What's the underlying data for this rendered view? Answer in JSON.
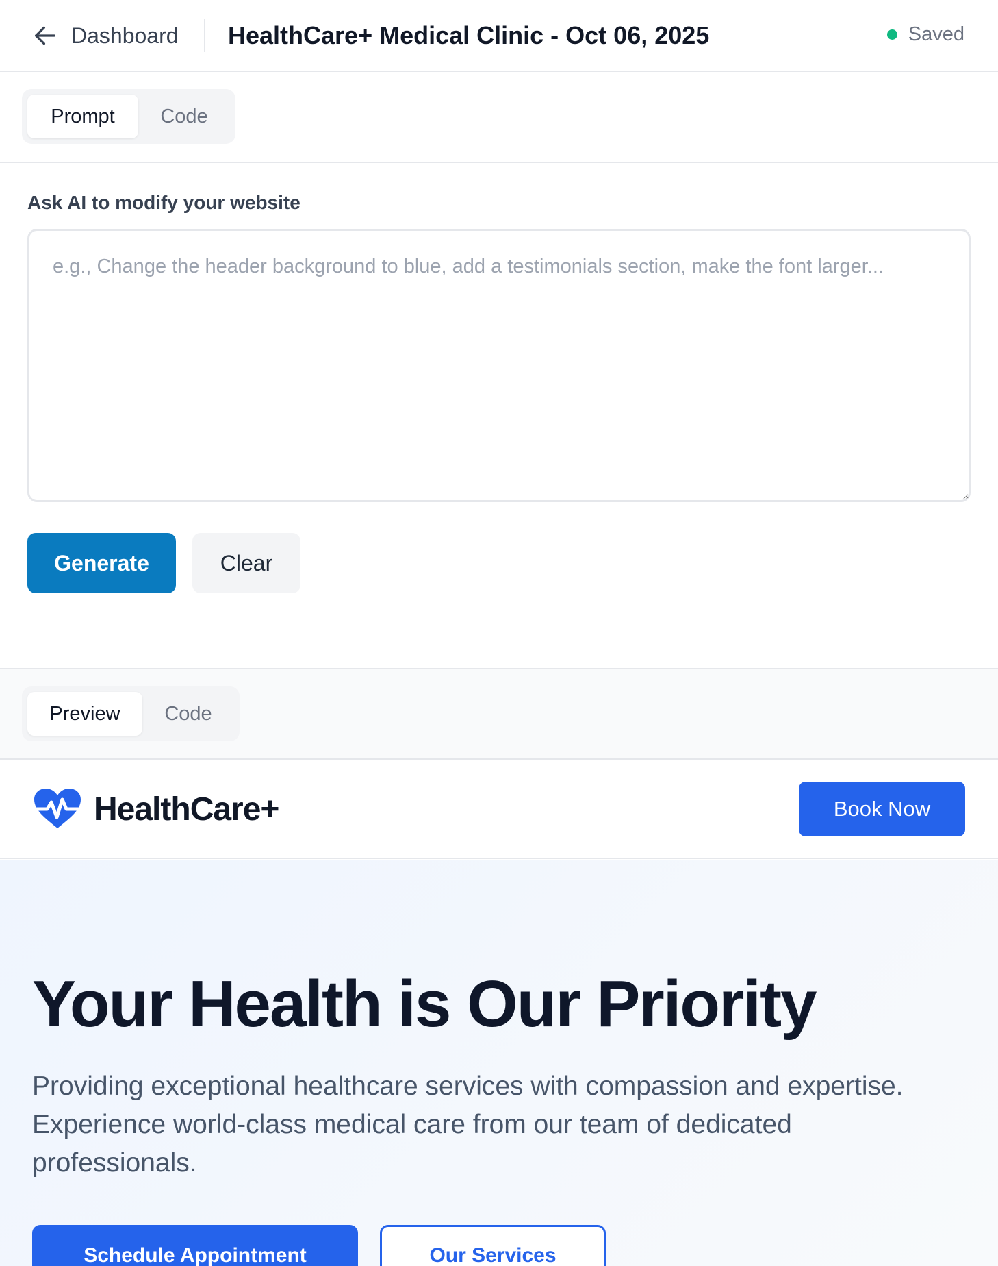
{
  "header": {
    "back_label": "Dashboard",
    "title": "HealthCare+ Medical Clinic - Oct 06, 2025",
    "status_label": "Saved",
    "status_color": "#10b981"
  },
  "editor_tabs": [
    {
      "label": "Prompt",
      "active": true
    },
    {
      "label": "Code",
      "active": false
    }
  ],
  "prompt": {
    "label": "Ask AI to modify your website",
    "value": "",
    "placeholder": "e.g., Change the header background to blue, add a testimonials section, make the font larger...",
    "generate_label": "Generate",
    "clear_label": "Clear"
  },
  "preview_tabs": [
    {
      "label": "Preview",
      "active": true
    },
    {
      "label": "Code",
      "active": false
    }
  ],
  "site": {
    "logo_text": "HealthCare+",
    "logo_icon": "heart-pulse-icon",
    "book_label": "Book Now",
    "hero_title": "Your Health is Our Priority",
    "hero_subtitle": "Providing exceptional healthcare services with compassion and expertise. Experience world-class medical care from our team of dedicated professionals.",
    "primary_cta": "Schedule Appointment",
    "secondary_cta": "Our Services",
    "brand_color": "#2563eb"
  },
  "colors": {
    "generate_button": "#0a7bbf",
    "saved_dot": "#10b981"
  }
}
